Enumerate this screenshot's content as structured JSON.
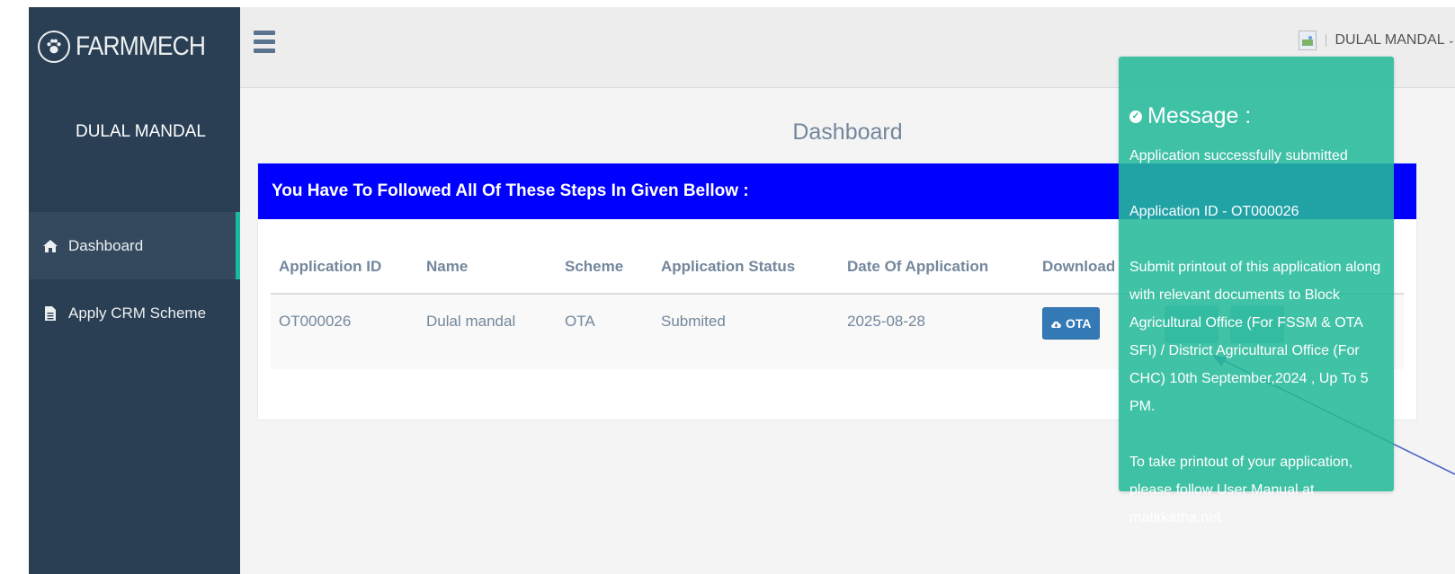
{
  "sidebar": {
    "brand": "FARMMECH",
    "profile_name": "DULAL MANDAL",
    "items": [
      {
        "label": "Dashboard"
      },
      {
        "label": "Apply CRM Scheme"
      }
    ]
  },
  "topbar": {
    "user_name": "DULAL MANDAL"
  },
  "main": {
    "title": "Dashboard",
    "panel_header": "You Have To Followed All Of These Steps In Given Bellow :",
    "table": {
      "headers": [
        "Application ID",
        "Name",
        "Scheme",
        "Application Status",
        "Date Of Application",
        "Download"
      ],
      "rows": [
        {
          "application_id": "OT000026",
          "name": "Dulal mandal",
          "scheme": "OTA",
          "status": "Submited",
          "date": "2025-08-28",
          "download_label": "OTA"
        }
      ]
    }
  },
  "toast": {
    "title": "Message :",
    "line1": "Application successfully submitted",
    "line2": "Application ID - OT000026",
    "line3": "Submit printout of this application along with relevant documents to Block Agricultural Office (For FSSM & OTA SFI) / District Agricultural Office (For CHC) 10th September,2024 , Up To 5 PM.",
    "line4": "To take printout of your application, please follow User Manual at matirkatha.net"
  },
  "colors": {
    "sidebar": "#2a3f54",
    "accent": "#1abb9c",
    "panel_header": "#0000ff",
    "toast": "#26b99a",
    "button": "#337ab7"
  }
}
